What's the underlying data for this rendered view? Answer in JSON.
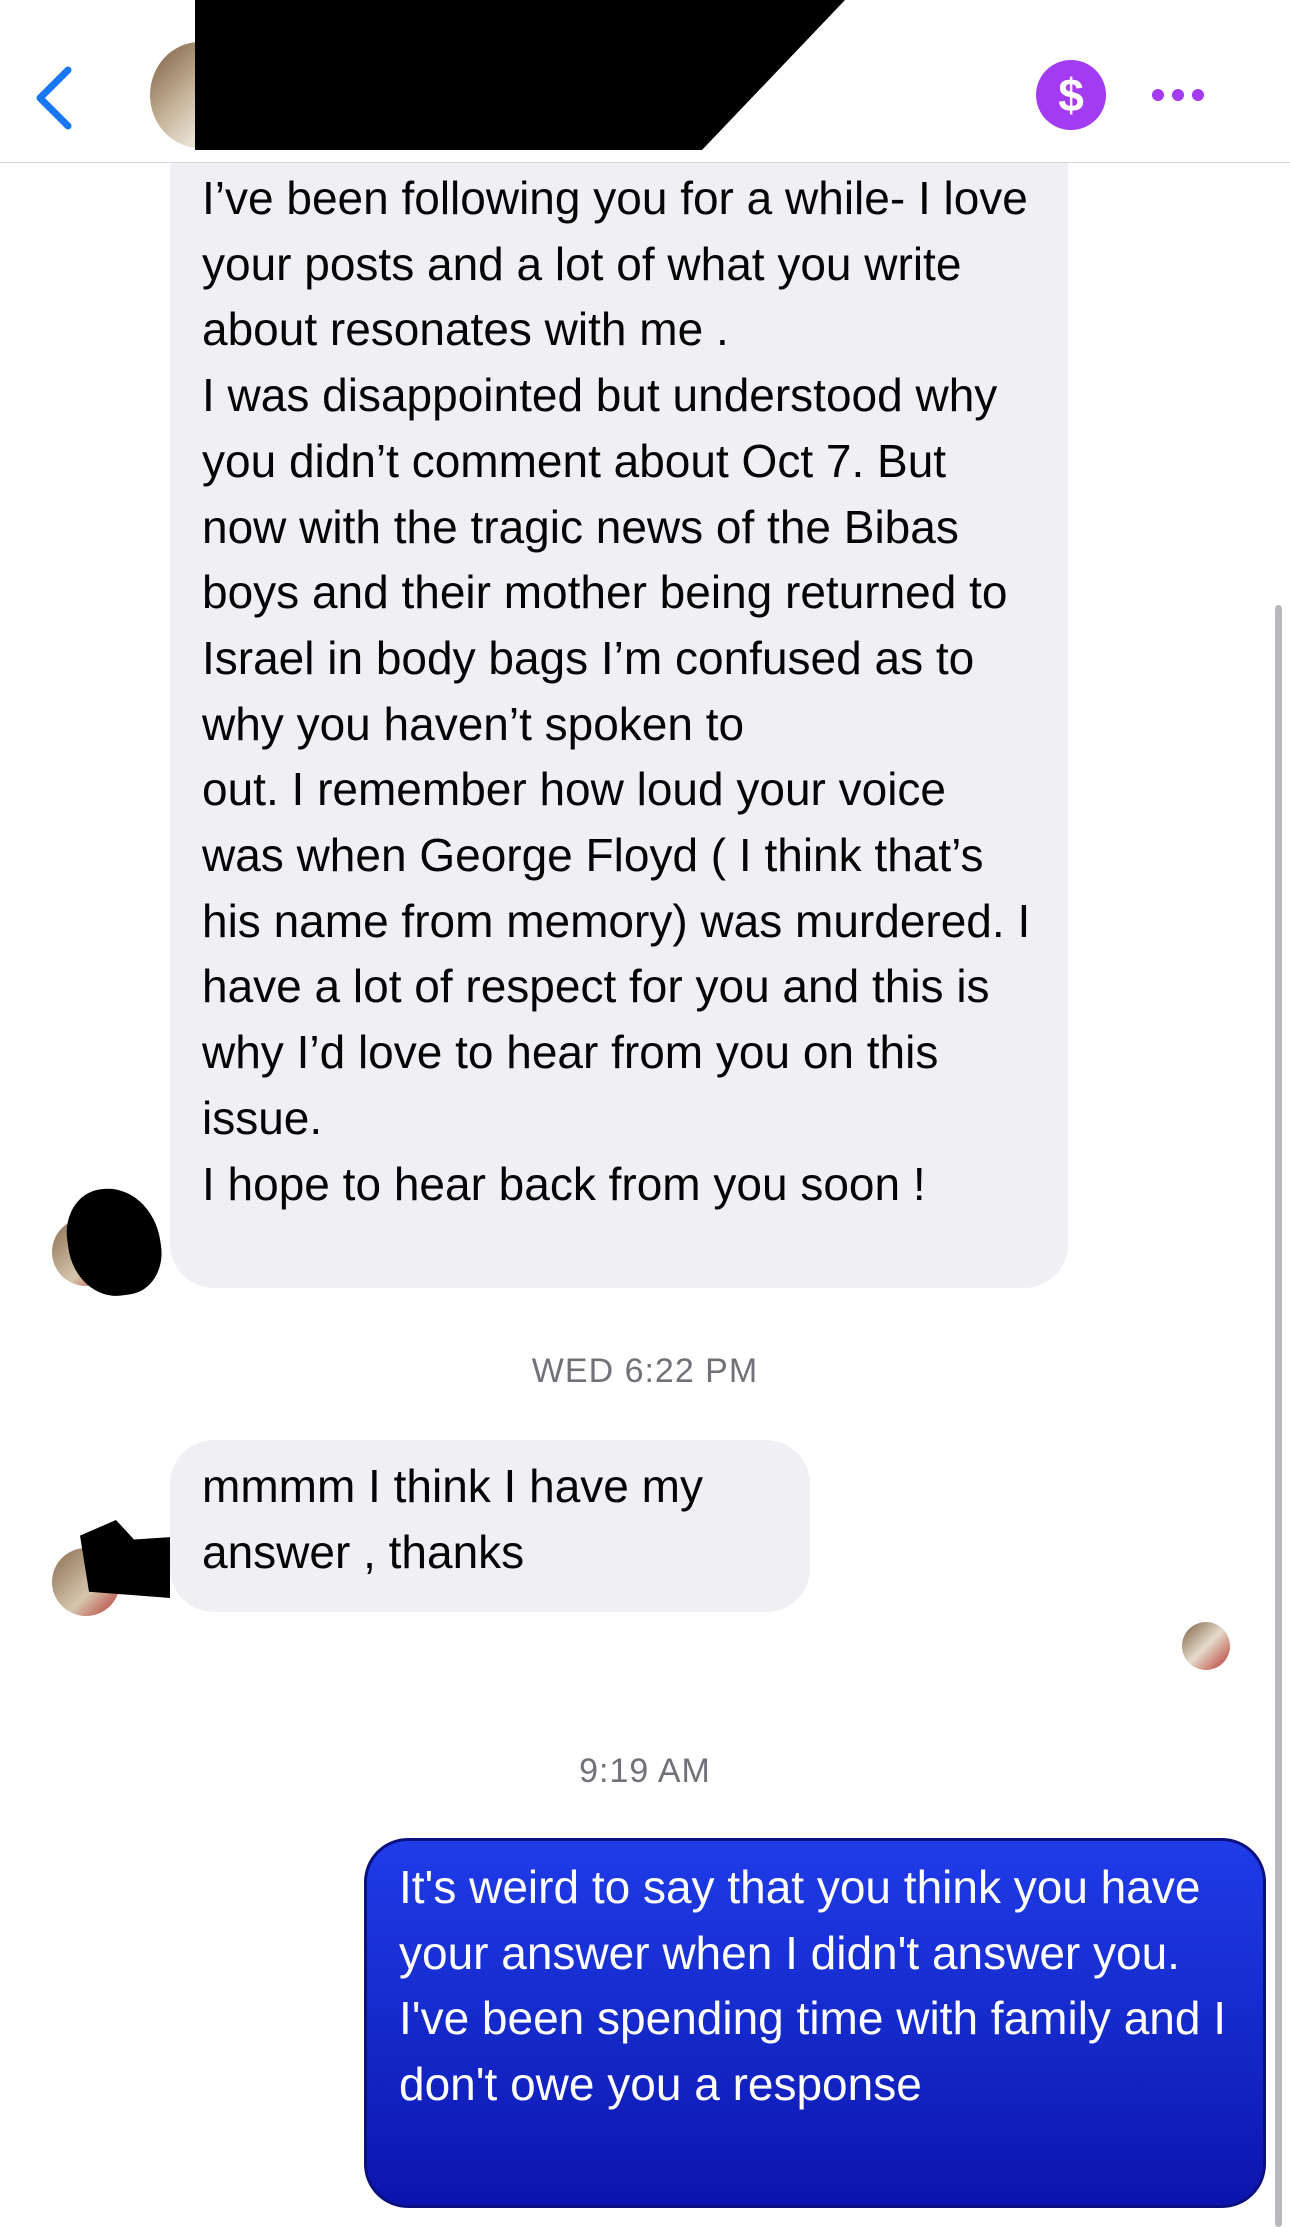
{
  "header": {
    "contact_name": "",
    "back_icon": "chevron-left-icon",
    "pay_icon": "dollar-icon",
    "pay_label": "$",
    "more_icon": "ellipsis-icon",
    "accent_color": "#1877f2",
    "pay_color": "#a33bf2"
  },
  "messages": [
    {
      "direction": "incoming",
      "text": "I’ve been following you for a while- I love your posts and a lot of what you write about resonates with me .\nI was disappointed but understood why you didn’t comment about Oct 7. But now with the tragic news of the Bibas boys and their mother being returned to Israel in body bags I’m confused as to why you haven’t spoken to\n out. I remember how loud your voice was when George Floyd ( I think that’s his name from memory) was murdered. I have a lot of respect for you and this is why I’d love to hear from you on this issue.\nI hope to hear  back from you soon !"
    },
    {
      "direction": "incoming",
      "text": "mmmm I think I have my answer , thanks"
    },
    {
      "direction": "outgoing",
      "text": "It's weird to say that you think you have your answer when I didn't answer you. I've been spending time with family and I don't owe you a response"
    }
  ],
  "timestamps": {
    "first": "WED 6:22 PM",
    "second": "9:19 AM"
  },
  "colors": {
    "incoming_bubble": "#f0f0f4",
    "outgoing_bubble": "#1428c8",
    "timestamp_text": "#717177"
  }
}
